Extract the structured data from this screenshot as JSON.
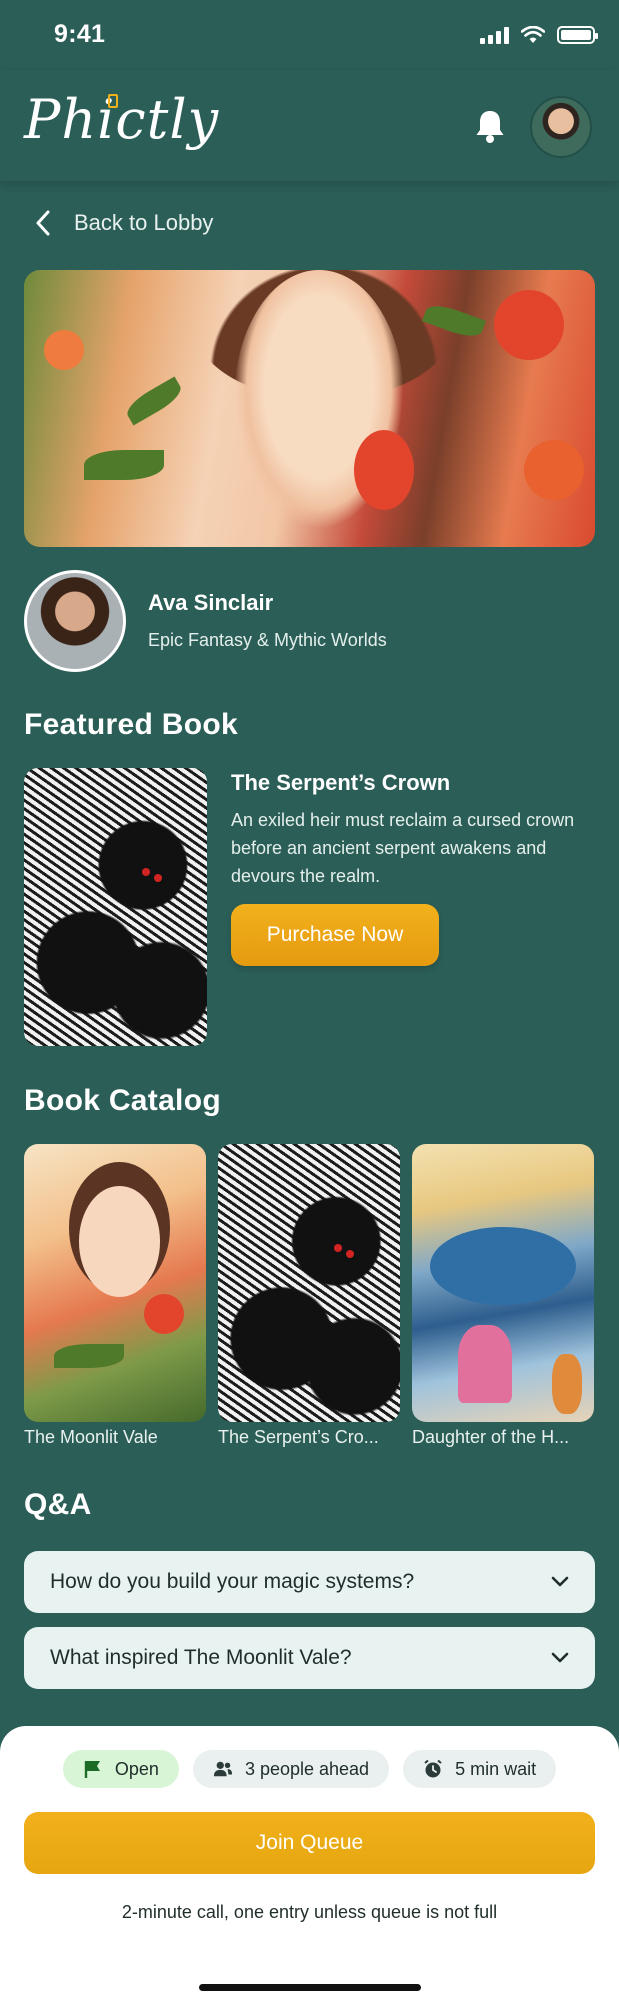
{
  "status_bar": {
    "time": "9:41"
  },
  "header": {
    "logo": "Phictly",
    "bell_icon": "bell-icon",
    "avatar": "user-avatar"
  },
  "nav": {
    "back_label": "Back to Lobby"
  },
  "author": {
    "name": "Ava Sinclair",
    "genre": "Epic Fantasy & Mythic Worlds"
  },
  "featured": {
    "section_title": "Featured Book",
    "book_title": "The Serpent’s Crown",
    "description": "An exiled heir must reclaim a cursed crown before an ancient serpent awakens and devours the realm.",
    "purchase_label": "Purchase Now"
  },
  "catalog": {
    "section_title": "Book Catalog",
    "books": [
      {
        "title": "The Moonlit Vale"
      },
      {
        "title": "The Serpent’s Cro..."
      },
      {
        "title": "Daughter of the H..."
      }
    ]
  },
  "qa": {
    "section_title": "Q&A",
    "items": [
      {
        "question": "How do you build your magic systems?"
      },
      {
        "question": "What inspired The Moonlit Vale?"
      }
    ]
  },
  "queue": {
    "status": "Open",
    "ahead": "3 people ahead",
    "wait": "5 min wait",
    "join_label": "Join Queue",
    "note": "2-minute call, one entry unless queue is not full"
  },
  "colors": {
    "background": "#2b5e57",
    "accent": "#f0aa17",
    "card": "#e8f2f1"
  }
}
